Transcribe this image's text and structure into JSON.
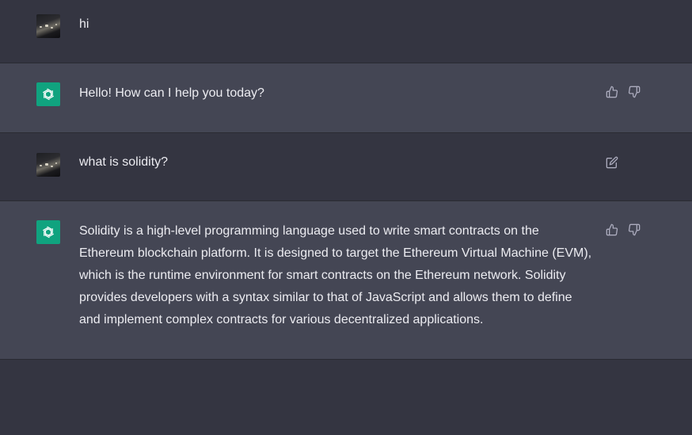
{
  "conversation": {
    "messages": [
      {
        "role": "user",
        "text": "hi"
      },
      {
        "role": "assistant",
        "text": "Hello! How can I help you today?"
      },
      {
        "role": "user",
        "text": "what is solidity?"
      },
      {
        "role": "assistant",
        "text": "Solidity is a high-level programming language used to write smart contracts on the Ethereum blockchain platform. It is designed to target the Ethereum Virtual Machine (EVM), which is the runtime environment for smart contracts on the Ethereum network. Solidity provides developers with a syntax similar to that of JavaScript and allows them to define and implement complex contracts for various decentralized applications."
      }
    ]
  },
  "icons": {
    "thumbs_up": "thumbs-up-icon",
    "thumbs_down": "thumbs-down-icon",
    "edit": "edit-icon",
    "bot_logo": "openai-logo-icon"
  },
  "colors": {
    "user_bg": "#343541",
    "assistant_bg": "#444654",
    "bot_avatar": "#10a37f",
    "text": "#ececf1",
    "icon": "#acacbe"
  }
}
